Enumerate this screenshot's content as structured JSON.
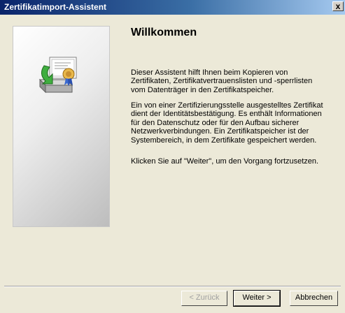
{
  "window": {
    "title": "Zertifikatimport-Assistent",
    "close_label": "x"
  },
  "side_panel": {
    "icon": "certificate-import-icon"
  },
  "content": {
    "heading": "Willkommen",
    "paragraph1": "Dieser Assistent hilft Ihnen beim Kopieren von Zertifikaten, Zertifikatvertrauenslisten und -sperrlisten vom Datenträger in den Zertifikatspeicher.",
    "paragraph2": "Ein von einer Zertifizierungsstelle ausgestelltes Zertifikat dient der Identitätsbestätigung. Es enthält Informationen für den Datenschutz oder für den Aufbau sicherer Netzwerkverbindungen. Ein Zertifikatspeicher ist der Systembereich, in dem Zertifikate gespeichert werden.",
    "paragraph3": "Klicken Sie auf \"Weiter\", um den Vorgang fortzusetzen."
  },
  "buttons": {
    "back": "< Zurück",
    "next": "Weiter >",
    "cancel": "Abbrechen"
  }
}
